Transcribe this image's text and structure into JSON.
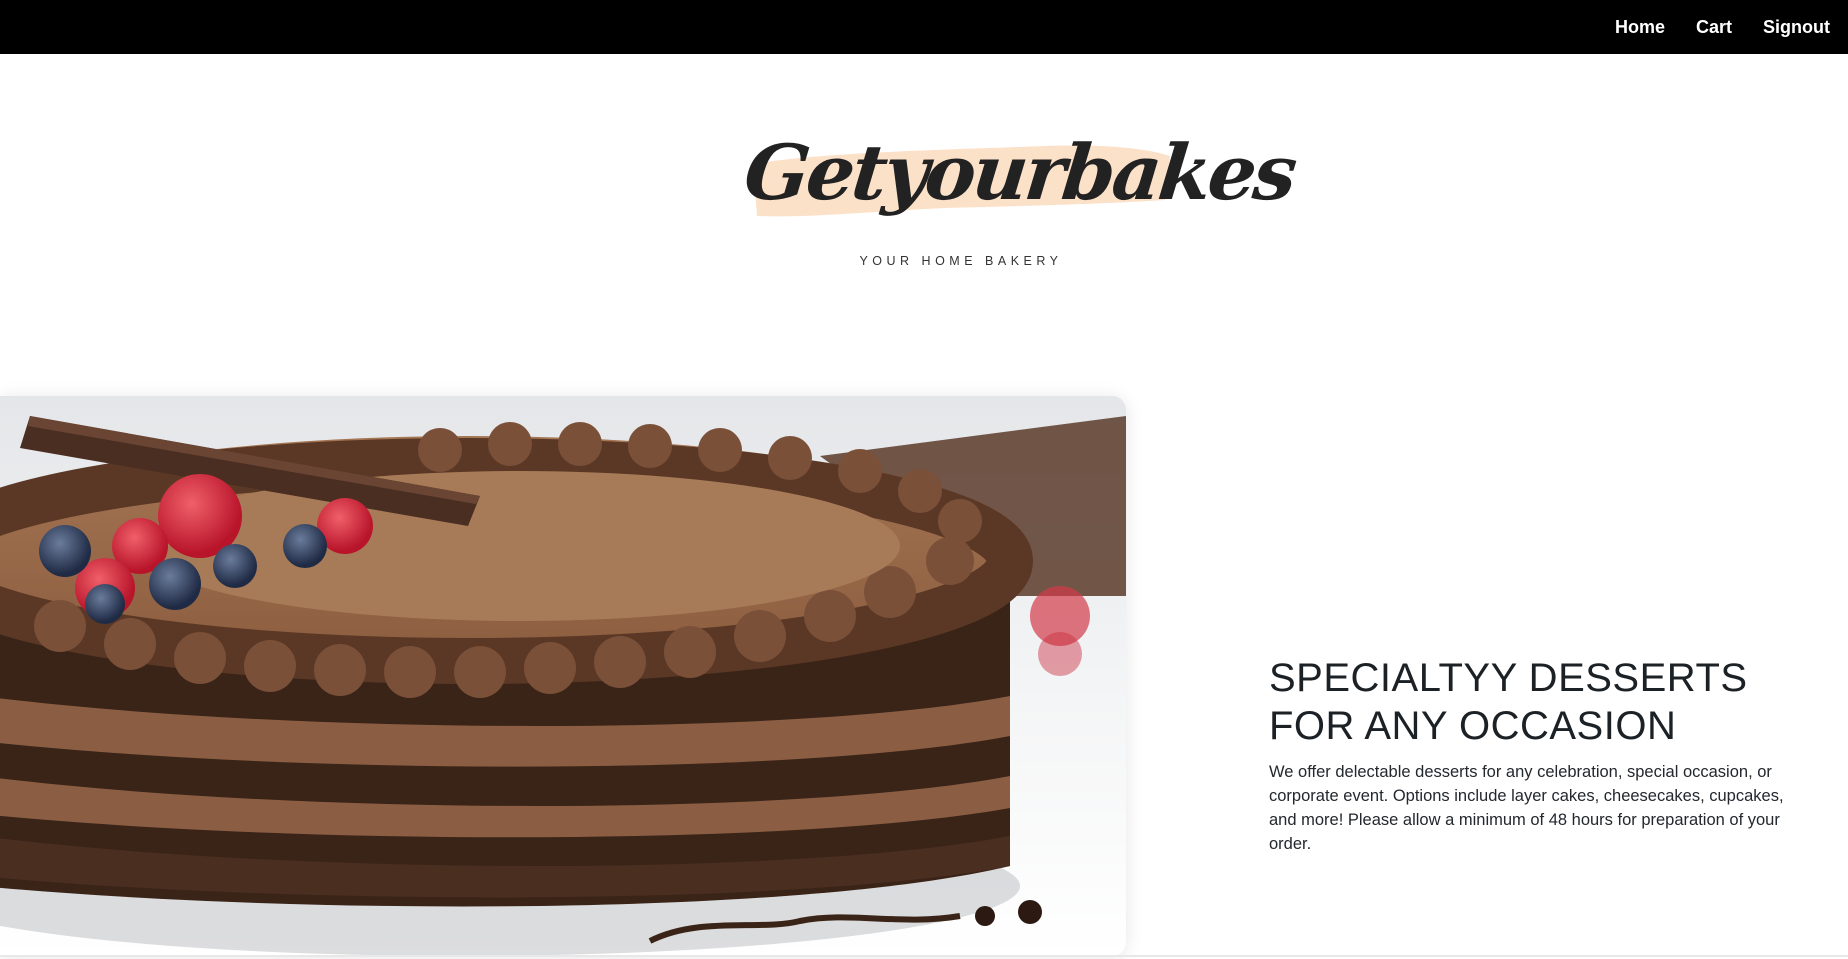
{
  "nav": {
    "home": "Home",
    "cart": "Cart",
    "signout": "Signout"
  },
  "logo": {
    "brand": "Getyourbakes",
    "tagline": "YOUR HOME BAKERY",
    "brush_color": "#fcdcc0"
  },
  "hero": {
    "image_icon": "chocolate-layer-cake-photo",
    "headline_line1": "SPECIALTYY DESSERTS",
    "headline_line2": "FOR ANY OCCASION",
    "description": "We offer delectable desserts for any celebration, special occasion, or corporate event. Options include layer cakes, cheesecakes, cupcakes, and more! Please allow a minimum of 48 hours for preparation of your order."
  }
}
